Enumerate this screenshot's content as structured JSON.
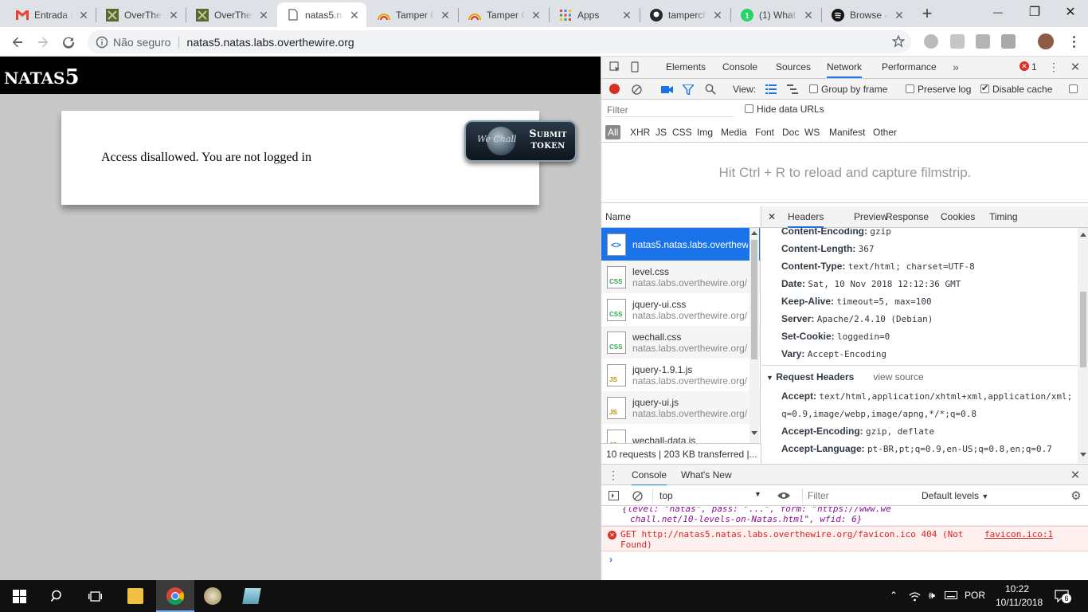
{
  "browser": {
    "tabs": [
      {
        "title": "Entrada (",
        "icon": "gmail-icon"
      },
      {
        "title": "OverTheW",
        "icon": "overthewire-icon"
      },
      {
        "title": "OverTheW",
        "icon": "overthewire-icon"
      },
      {
        "title": "natas5.na",
        "icon": "page-icon",
        "active": true
      },
      {
        "title": "Tamper C",
        "icon": "tamper-icon"
      },
      {
        "title": "Tamper C",
        "icon": "tamper-icon"
      },
      {
        "title": "Apps",
        "icon": "apps-icon"
      },
      {
        "title": "tamperch",
        "icon": "github-icon"
      },
      {
        "title": "(1) What",
        "icon": "whatsapp-icon"
      },
      {
        "title": "Browse -",
        "icon": "spotify-icon"
      }
    ],
    "security_label": "Não seguro",
    "url": "natas5.natas.labs.overthewire.org"
  },
  "page": {
    "header_prefix": "NATAS",
    "header_number": "5",
    "message": "Access disallowed. You are not logged in",
    "wechall_logo": "We Chall",
    "submit_line1": "Submit",
    "submit_line2": "token"
  },
  "devtools": {
    "tabs": [
      "Elements",
      "Console",
      "Sources",
      "Network",
      "Performance"
    ],
    "active_tab": "Network",
    "error_count": "1",
    "view_label": "View:",
    "group_by_frame": "Group by frame",
    "preserve_log": "Preserve log",
    "disable_cache": "Disable cache",
    "filter_placeholder": "Filter",
    "hide_data_urls": "Hide data URLs",
    "filter_types": [
      "All",
      "XHR",
      "JS",
      "CSS",
      "Img",
      "Media",
      "Font",
      "Doc",
      "WS",
      "Manifest",
      "Other"
    ],
    "filmstrip_hint": "Hit Ctrl + R to reload and capture filmstrip.",
    "name_header": "Name",
    "requests": [
      {
        "name": "natas5.natas.labs.overthewire.org",
        "domain": "",
        "type": "doc",
        "selected": true
      },
      {
        "name": "level.css",
        "domain": "natas.labs.overthewire.org/",
        "type": "CSS"
      },
      {
        "name": "jquery-ui.css",
        "domain": "natas.labs.overthewire.org/",
        "type": "CSS"
      },
      {
        "name": "wechall.css",
        "domain": "natas.labs.overthewire.org/",
        "type": "CSS"
      },
      {
        "name": "jquery-1.9.1.js",
        "domain": "natas.labs.overthewire.org/",
        "type": "JS"
      },
      {
        "name": "jquery-ui.js",
        "domain": "natas.labs.overthewire.org/",
        "type": "JS"
      },
      {
        "name": "wechall-data.js",
        "domain": "",
        "type": "JS"
      }
    ],
    "summary": "10 requests  |  203 KB transferred  |...",
    "detail_tabs": [
      "Headers",
      "Preview",
      "Response",
      "Cookies",
      "Timing"
    ],
    "response_headers": [
      {
        "key": "Content-Encoding:",
        "value": "gzip"
      },
      {
        "key": "Content-Length:",
        "value": "367"
      },
      {
        "key": "Content-Type:",
        "value": "text/html; charset=UTF-8"
      },
      {
        "key": "Date:",
        "value": "Sat, 10 Nov 2018 12:12:36 GMT"
      },
      {
        "key": "Keep-Alive:",
        "value": "timeout=5, max=100"
      },
      {
        "key": "Server:",
        "value": "Apache/2.4.10 (Debian)"
      },
      {
        "key": "Set-Cookie:",
        "value": "loggedin=0"
      },
      {
        "key": "Vary:",
        "value": "Accept-Encoding"
      }
    ],
    "request_headers_title": "Request Headers",
    "view_source": "view source",
    "request_headers": [
      {
        "key": "Accept:",
        "value": "text/html,application/xhtml+xml,application/xml;"
      },
      {
        "key": "",
        "value": "q=0.9,image/webp,image/apng,*/*;q=0.8"
      },
      {
        "key": "Accept-Encoding:",
        "value": "gzip, deflate"
      },
      {
        "key": "Accept-Language:",
        "value": "pt-BR,pt;q=0.9,en-US;q=0.8,en;q=0.7"
      }
    ],
    "drawer_tabs": [
      "Console",
      "What's New"
    ],
    "context": "top",
    "console_filter": "Filter",
    "levels": "Default levels",
    "console_cut_line1": "{level: \"natas\", pass: \"...\", form: \"https://www.we",
    "console_cut_line2": "chall.net/10-levels-on-Natas.html\", wfid: 6}",
    "error_text": "GET http://natas5.natas.labs.overthewire.org/favicon.ico 404 (Not",
    "error_text2": "Found)",
    "error_source": "favicon.ico:1"
  },
  "taskbar": {
    "lang": "POR",
    "time": "10:22",
    "date": "10/11/2018",
    "notifications": "6"
  }
}
